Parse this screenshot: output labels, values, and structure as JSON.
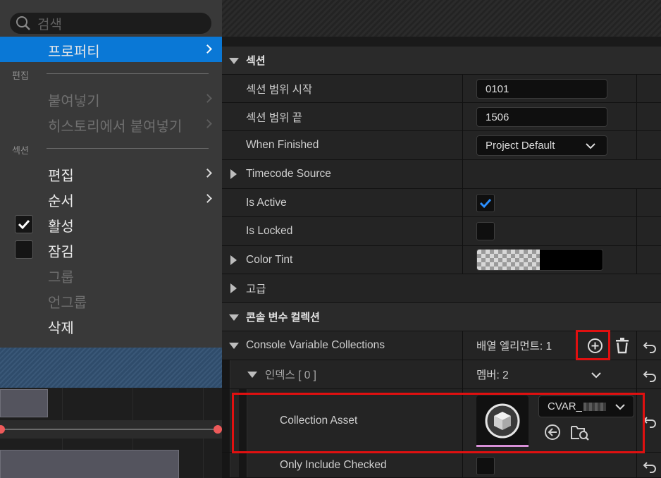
{
  "menu": {
    "search_placeholder": "검색",
    "selected_item": "프로퍼티",
    "sections": [
      {
        "label": "편집",
        "items": [
          {
            "label": "붙여넣기",
            "enabled": false,
            "submenu": true
          },
          {
            "label": "히스토리에서 붙여넣기",
            "enabled": false,
            "submenu": true
          }
        ]
      },
      {
        "label": "섹션",
        "items": [
          {
            "label": "편집",
            "enabled": true,
            "submenu": true
          },
          {
            "label": "순서",
            "enabled": true,
            "submenu": true
          },
          {
            "label": "활성",
            "enabled": true,
            "checked": true
          },
          {
            "label": "잠김",
            "enabled": true,
            "checked": false
          },
          {
            "label": "그룹",
            "enabled": false
          },
          {
            "label": "언그룹",
            "enabled": false
          },
          {
            "label": "삭제",
            "enabled": true
          }
        ]
      }
    ]
  },
  "details": {
    "category_section": "섹션",
    "section_range_start_label": "섹션 범위 시작",
    "section_range_start_value": "0101",
    "section_range_end_label": "섹션 범위 끝",
    "section_range_end_value": "1506",
    "when_finished_label": "When Finished",
    "when_finished_value": "Project Default",
    "timecode_source_label": "Timecode Source",
    "is_active_label": "Is Active",
    "is_active_checked": true,
    "is_locked_label": "Is Locked",
    "is_locked_checked": false,
    "color_tint_label": "Color Tint",
    "advanced_label": "고급",
    "category_cvars": "콘솔 변수 컬렉션",
    "cvar_collections_label": "Console Variable Collections",
    "array_elements_text": "배열 엘리먼트: 1",
    "index_label": "인덱스 [ 0 ]",
    "members_text": "멤버: 2",
    "collection_asset_label": "Collection Asset",
    "collection_asset_value": "CVAR_",
    "only_include_checked_label": "Only Include Checked",
    "only_include_checked": false
  },
  "colors": {
    "menu_selection": "#0a78d6",
    "checkbox_check": "#2b8fff",
    "highlight_box": "#e01010"
  }
}
